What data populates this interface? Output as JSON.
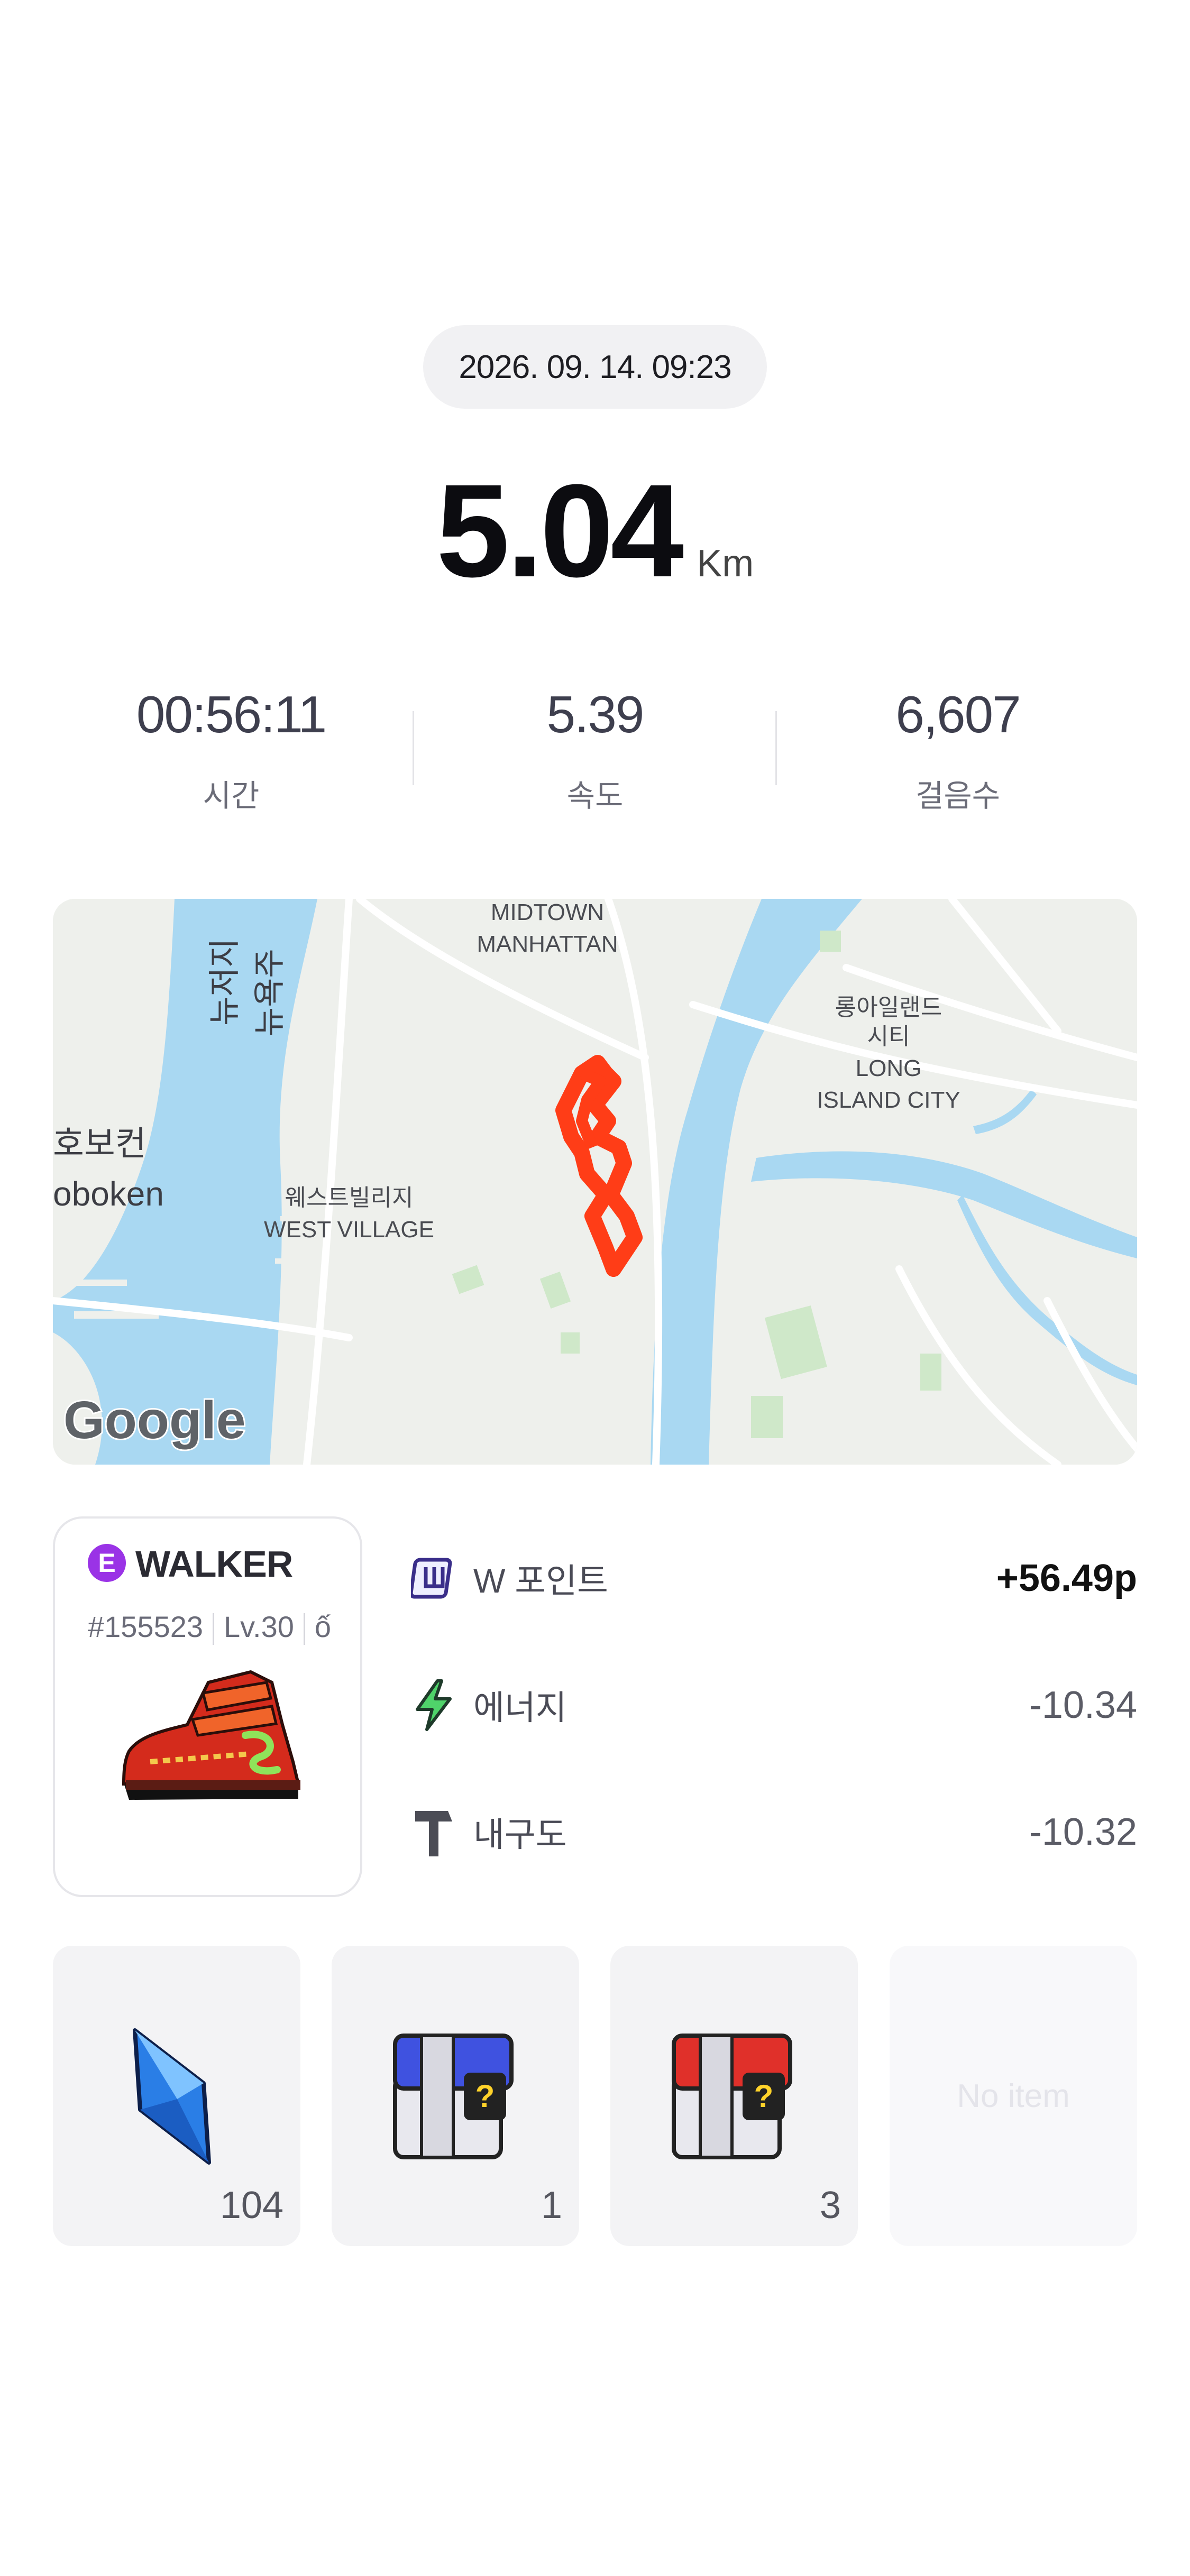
{
  "header": {
    "datetime": "2026. 09. 14. 09:23"
  },
  "distance": {
    "value": "5.04",
    "unit": "Km"
  },
  "stats": [
    {
      "value": "00:56:11",
      "label": "시간"
    },
    {
      "value": "5.39",
      "label": "속도"
    },
    {
      "value": "6,607",
      "label": "걸음수"
    }
  ],
  "map": {
    "labels": {
      "midtown_1": "MIDTOWN",
      "midtown_2": "MANHATTAN",
      "newjersey_ko_1": "뉴저지",
      "newjersey_ko_2": "뉴욕주",
      "hoboken_ko": "호보컨",
      "hoboken_en": "oboken",
      "westvillage_ko": "웨스트빌리지",
      "westvillage_en": "WEST VILLAGE",
      "lic_ko_1": "롱아일랜드",
      "lic_ko_2": "시티",
      "lic_en_1": "LONG",
      "lic_en_2": "ISLAND CITY",
      "logo": "Google"
    },
    "route_color": "#ff3d17"
  },
  "shoe": {
    "grade": "E",
    "type": "WALKER",
    "id": "#155523",
    "level": "Lv.30",
    "extra": "ố",
    "grade_color": "#9a33e6"
  },
  "rewards": [
    {
      "icon": "w-point-icon",
      "label": "W 포인트",
      "value": "+56.49p"
    },
    {
      "icon": "energy-bolt-icon",
      "label": "에너지",
      "value": "-10.34"
    },
    {
      "icon": "durability-hammer-icon",
      "label": "내구도",
      "value": "-10.32"
    }
  ],
  "items": [
    {
      "icon": "blue-gem-icon",
      "count": "104"
    },
    {
      "icon": "blue-mystery-box-icon",
      "count": "1"
    },
    {
      "icon": "red-mystery-box-icon",
      "count": "3"
    },
    {
      "icon": "",
      "count": "",
      "empty_text": "No item"
    }
  ]
}
